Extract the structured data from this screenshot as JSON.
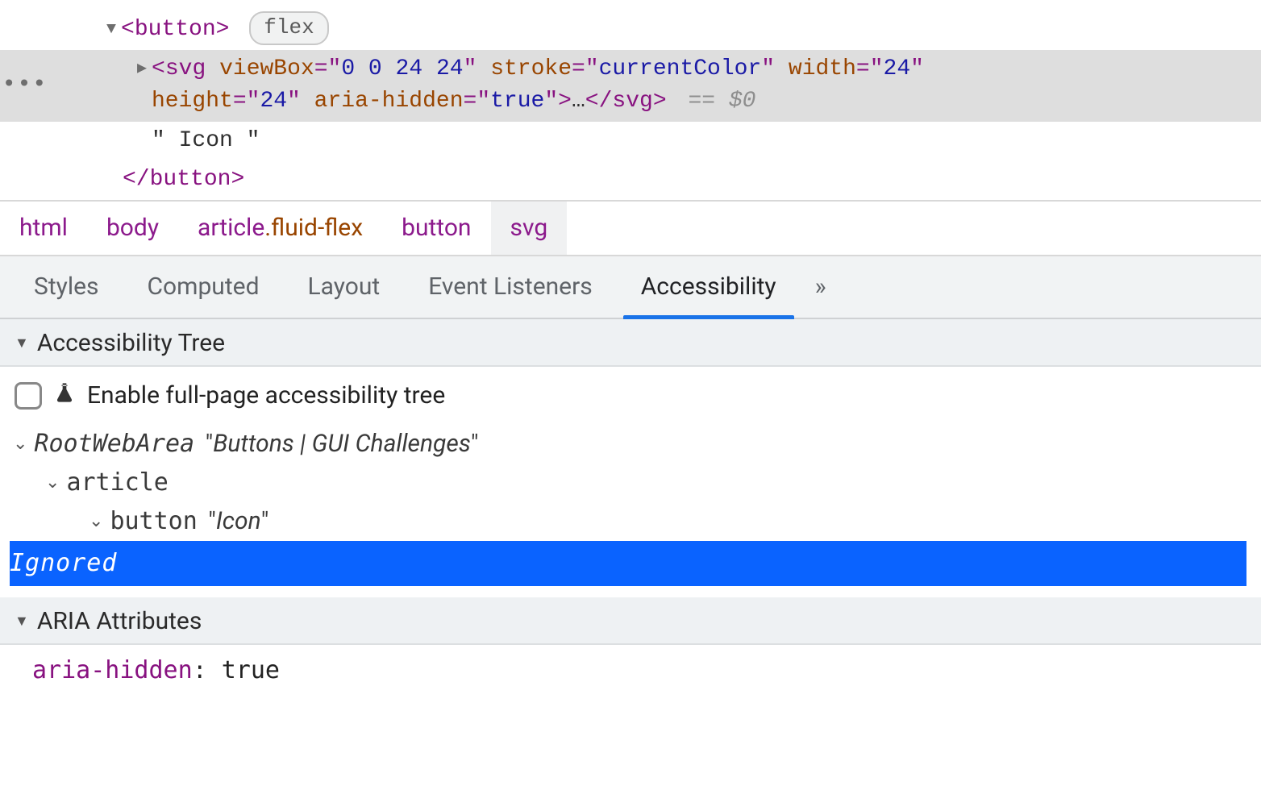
{
  "dom": {
    "button_open": "button",
    "badge": "flex",
    "svg": {
      "tag": "svg",
      "attrs": [
        {
          "name": "viewBox",
          "value": "0 0 24 24"
        },
        {
          "name": "stroke",
          "value": "currentColor"
        },
        {
          "name": "width",
          "value": "24"
        },
        {
          "name": "height",
          "value": "24"
        },
        {
          "name": "aria-hidden",
          "value": "true"
        }
      ],
      "ellipsis": "…",
      "close": "svg"
    },
    "console_ref": "== $0",
    "text_node": "\" Icon \"",
    "button_close": "button",
    "gutter_dots": "•••"
  },
  "breadcrumb": [
    {
      "label": "html",
      "class": ""
    },
    {
      "label": "body",
      "class": ""
    },
    {
      "label": "article",
      "class": ".fluid-flex"
    },
    {
      "label": "button",
      "class": ""
    },
    {
      "label": "svg",
      "class": "",
      "selected": true
    }
  ],
  "tabs": {
    "items": [
      "Styles",
      "Computed",
      "Layout",
      "Event Listeners",
      "Accessibility"
    ],
    "active": 4,
    "overflow": "»"
  },
  "a11y": {
    "tree_header": "Accessibility Tree",
    "enable_label": "Enable full-page accessibility tree",
    "nodes": {
      "root_role": "RootWebArea",
      "root_name": "Buttons | GUI Challenges",
      "article_role": "article",
      "button_role": "button",
      "button_name": "Icon",
      "ignored": "Ignored"
    },
    "aria_header": "ARIA Attributes",
    "aria_attr_name": "aria-hidden",
    "aria_attr_value": "true"
  }
}
